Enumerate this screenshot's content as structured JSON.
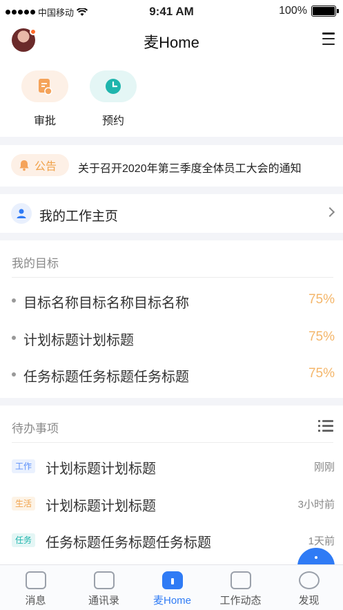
{
  "status_bar": {
    "carrier": "中国移动",
    "time": "9:41 AM",
    "battery": "100%"
  },
  "header": {
    "title": "麦Home"
  },
  "quick_actions": [
    {
      "label": "审批",
      "icon": "approval-document-icon",
      "color": "#f5a35a"
    },
    {
      "label": "预约",
      "icon": "clock-icon",
      "color": "#1fb5ad"
    }
  ],
  "notice": {
    "badge": "公告",
    "text": "关于召开2020年第三季度全体员工大会的通知"
  },
  "work_page": {
    "label": "我的工作主页"
  },
  "goals": {
    "title": "我的目标",
    "items": [
      {
        "name": "目标名称目标名称目标名称",
        "percent": "75%"
      },
      {
        "name": "计划标题计划标题",
        "percent": "75%"
      },
      {
        "name": "任务标题任务标题任务标题",
        "percent": "75%"
      }
    ]
  },
  "todo": {
    "title": "待办事项",
    "items": [
      {
        "tag": "工作",
        "tag_color": "#5b8ff9",
        "tag_bg": "#eaf1fe",
        "name": "计划标题计划标题",
        "time": "刚刚"
      },
      {
        "tag": "生活",
        "tag_color": "#f0a24a",
        "tag_bg": "#fdf3e6",
        "name": "计划标题计划标题",
        "time": "3小时前"
      },
      {
        "tag": "任务",
        "tag_color": "#1fb5ad",
        "tag_bg": "#e4f6f5",
        "name": "任务标题任务标题任务标题",
        "time": "1天前"
      }
    ]
  },
  "tabbar": {
    "tabs": [
      {
        "label": "消息",
        "icon": "message-icon"
      },
      {
        "label": "通讯录",
        "icon": "contacts-icon"
      },
      {
        "label": "麦Home",
        "icon": "home-icon",
        "active": true
      },
      {
        "label": "工作动态",
        "icon": "activity-icon"
      },
      {
        "label": "发现",
        "icon": "discover-icon"
      }
    ]
  },
  "colors": {
    "accent": "#2f7bf5",
    "percent": "#f4b66a"
  }
}
